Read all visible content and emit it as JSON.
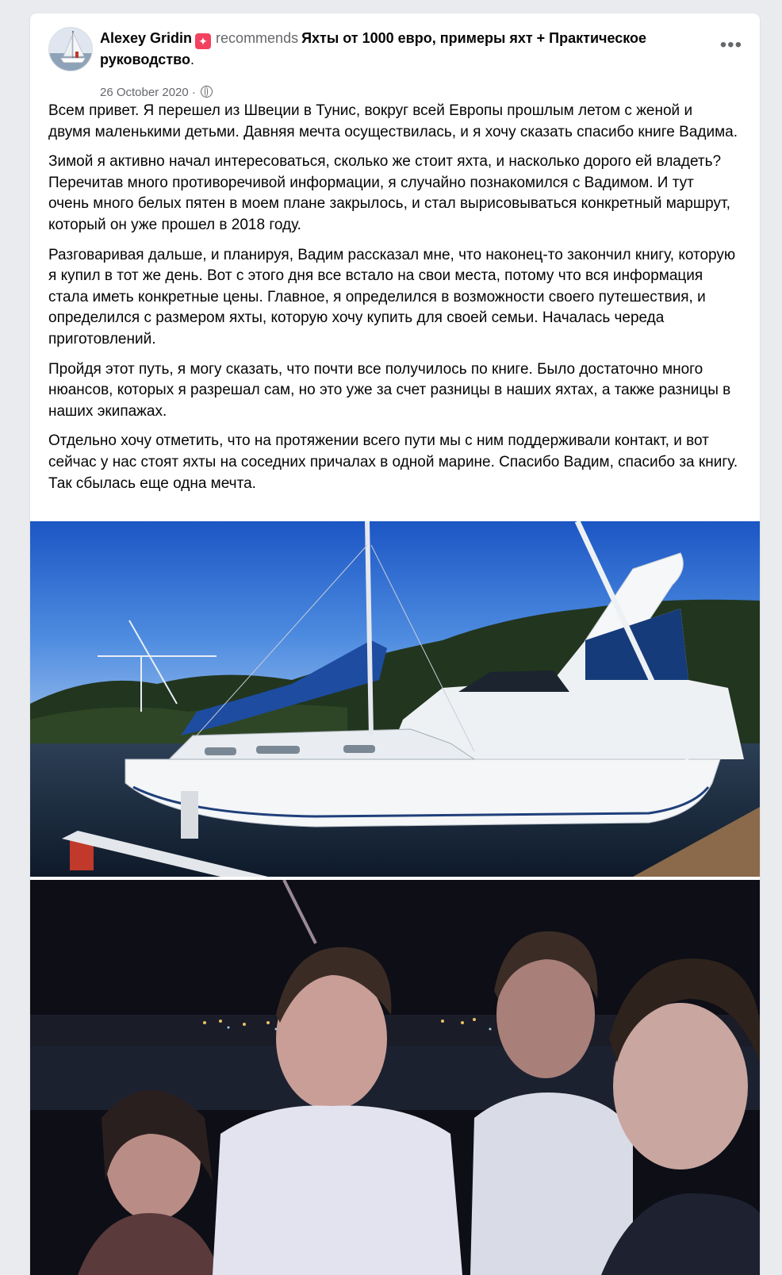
{
  "post": {
    "author": "Alexey Gridin",
    "recommends_label": "recommends",
    "page_name": "Яхты от 1000 евро, примеры яхт + Практическое руководство",
    "page_suffix": ".",
    "date": "26 October 2020",
    "date_separator": "·",
    "privacy_icon": "globe-icon",
    "more_icon": "more-options-icon",
    "recommend_icon": "recommend-star-icon",
    "more_label": "•••",
    "recommend_glyph": "✦",
    "paragraphs": [
      "Всем привет. Я перешел из Швеции в Тунис, вокруг всей Европы прошлым летом с женой и двумя маленькими детьми. Давняя мечта осуществилась, и я хочу сказать спасибо книге Вадима.",
      "Зимой я активно начал интересоваться, сколько же стоит яхта, и насколько дорого ей владеть? Перечитав много противоречивой информации, я случайно познакомился с Вадимом. И тут очень много белых пятен в моем плане закрылось, и стал вырисовываться конкретный маршрут, который он уже прошел в 2018 году.",
      "Разговаривая дальше, и планируя, Вадим рассказал мне, что наконец-то закончил книгу, которую я купил в тот же день. Вот с этого дня все встало на свои места, потому что вся информация стала иметь конкретные цены. Главное, я определился в возможности своего путешествия, и определился с размером яхты, которую хочу купить для своей семьи. Началась череда приготовлений.",
      "Пройдя этот путь, я могу сказать, что почти все получилось по книге. Было достаточно много нюансов, которых я разрешал сам, но это уже за счет разницы в наших яхтах, а также разницы в наших экипажах.",
      "Отдельно хочу отметить, что на протяжении всего пути мы с ним поддерживали контакт, и вот сейчас у нас стоят яхты на соседних причалах в одной марине. Спасибо Вадим, спасибо за книгу. Так сбылась еще одна мечта."
    ]
  },
  "colors": {
    "primary_text": "#050505",
    "secondary_text": "#65676b",
    "recommend_badge": "#f3425f",
    "page_background": "#e9ebee"
  }
}
